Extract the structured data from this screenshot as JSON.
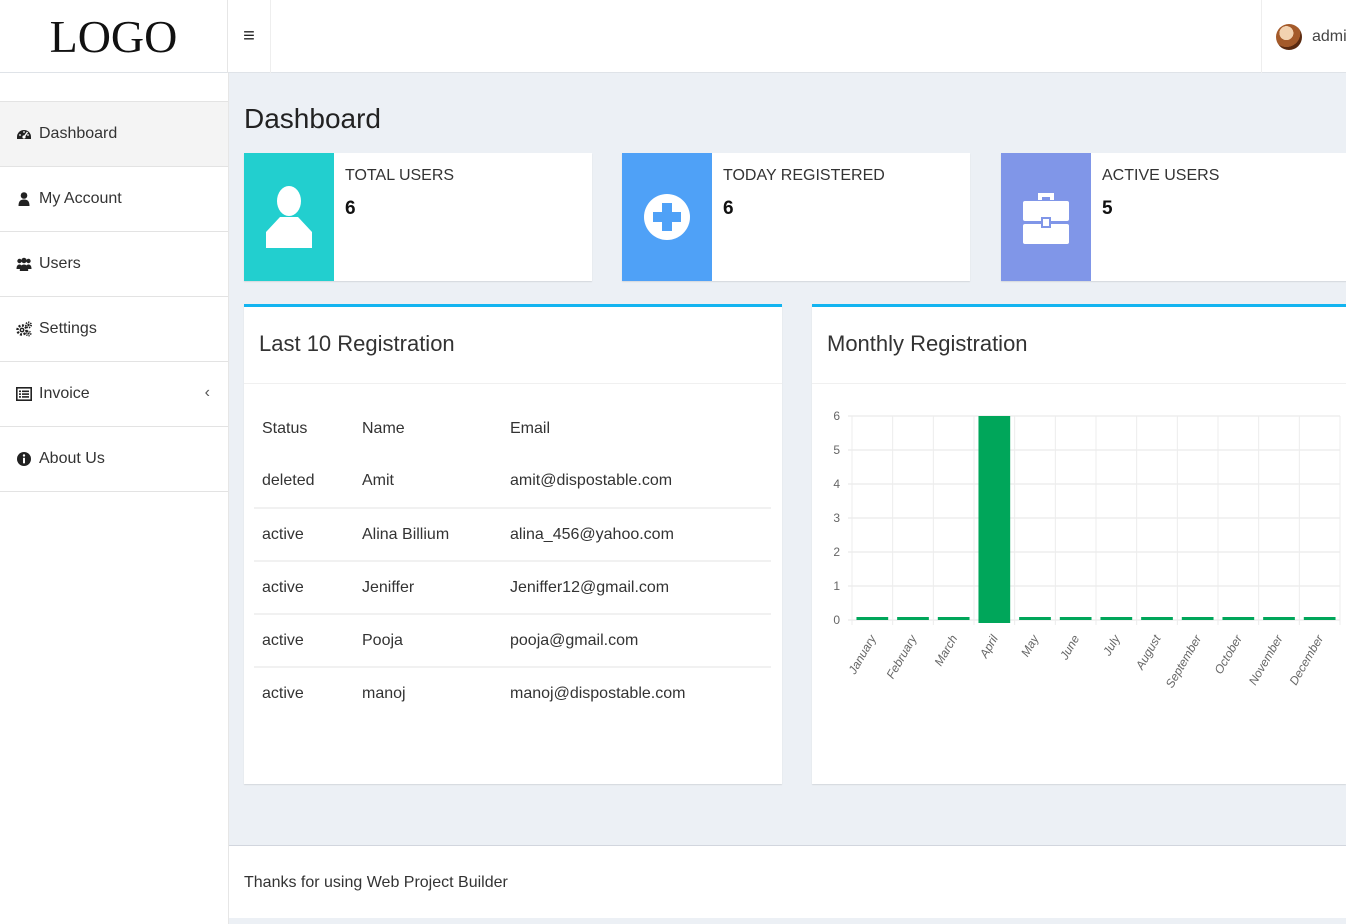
{
  "header": {
    "logo": "LOGO",
    "menu_toggle": "≡",
    "user_name": "admin"
  },
  "sidebar": {
    "items": [
      {
        "label": "Dashboard",
        "icon": "dashboard-icon",
        "active": true
      },
      {
        "label": "My Account",
        "icon": "user-icon"
      },
      {
        "label": "Users",
        "icon": "users-icon"
      },
      {
        "label": "Settings",
        "icon": "cogs-icon"
      },
      {
        "label": "Invoice",
        "icon": "list-icon",
        "chevron": "‹"
      },
      {
        "label": "About Us",
        "icon": "info-icon"
      }
    ]
  },
  "main": {
    "title": "Dashboard",
    "info_boxes": [
      {
        "label": "TOTAL USERS",
        "value": "6",
        "color": "#22cfcf",
        "icon": "user-silhouette-icon"
      },
      {
        "label": "TODAY REGISTERED",
        "value": "6",
        "color": "#4fa1f7",
        "icon": "plus-circle-icon"
      },
      {
        "label": "ACTIVE USERS",
        "value": "5",
        "color": "#8096e8",
        "icon": "briefcase-icon"
      }
    ],
    "registrations": {
      "title": "Last 10 Registration",
      "columns": [
        "Status",
        "Name",
        "Email"
      ],
      "rows": [
        [
          "deleted",
          "Amit",
          "amit@dispostable.com"
        ],
        [
          "active",
          "Alina Billium",
          "alina_456@yahoo.com"
        ],
        [
          "active",
          "Jeniffer",
          "Jeniffer12@gmail.com"
        ],
        [
          "active",
          "Pooja",
          "pooja@gmail.com"
        ],
        [
          "active",
          "manoj",
          "manoj@dispostable.com"
        ]
      ]
    },
    "monthly": {
      "title": "Monthly Registration"
    }
  },
  "chart_data": {
    "type": "bar",
    "categories": [
      "January",
      "February",
      "March",
      "April",
      "May",
      "June",
      "July",
      "August",
      "September",
      "October",
      "November",
      "December"
    ],
    "values": [
      0,
      0,
      0,
      6,
      0,
      0,
      0,
      0,
      0,
      0,
      0,
      0
    ],
    "ylim": [
      0,
      6
    ],
    "yticks": [
      "0",
      "1",
      "2",
      "3",
      "4",
      "5",
      "6"
    ],
    "grid": true,
    "bar_color": "#00a65a"
  },
  "footer": {
    "text": "Thanks for using Web Project Builder"
  },
  "colors": {
    "accent": "#13b4f0"
  }
}
